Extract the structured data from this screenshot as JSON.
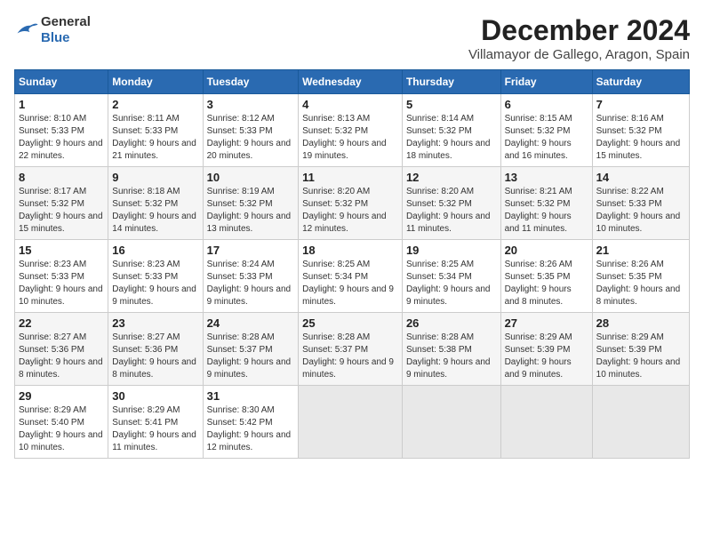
{
  "header": {
    "logo_general": "General",
    "logo_blue": "Blue",
    "title": "December 2024",
    "subtitle": "Villamayor de Gallego, Aragon, Spain"
  },
  "days_of_week": [
    "Sunday",
    "Monday",
    "Tuesday",
    "Wednesday",
    "Thursday",
    "Friday",
    "Saturday"
  ],
  "weeks": [
    [
      {
        "day": "1",
        "sunrise": "8:10 AM",
        "sunset": "5:33 PM",
        "daylight": "9 hours and 22 minutes."
      },
      {
        "day": "2",
        "sunrise": "8:11 AM",
        "sunset": "5:33 PM",
        "daylight": "9 hours and 21 minutes."
      },
      {
        "day": "3",
        "sunrise": "8:12 AM",
        "sunset": "5:33 PM",
        "daylight": "9 hours and 20 minutes."
      },
      {
        "day": "4",
        "sunrise": "8:13 AM",
        "sunset": "5:32 PM",
        "daylight": "9 hours and 19 minutes."
      },
      {
        "day": "5",
        "sunrise": "8:14 AM",
        "sunset": "5:32 PM",
        "daylight": "9 hours and 18 minutes."
      },
      {
        "day": "6",
        "sunrise": "8:15 AM",
        "sunset": "5:32 PM",
        "daylight": "9 hours and 16 minutes."
      },
      {
        "day": "7",
        "sunrise": "8:16 AM",
        "sunset": "5:32 PM",
        "daylight": "9 hours and 15 minutes."
      }
    ],
    [
      {
        "day": "8",
        "sunrise": "8:17 AM",
        "sunset": "5:32 PM",
        "daylight": "9 hours and 15 minutes."
      },
      {
        "day": "9",
        "sunrise": "8:18 AM",
        "sunset": "5:32 PM",
        "daylight": "9 hours and 14 minutes."
      },
      {
        "day": "10",
        "sunrise": "8:19 AM",
        "sunset": "5:32 PM",
        "daylight": "9 hours and 13 minutes."
      },
      {
        "day": "11",
        "sunrise": "8:20 AM",
        "sunset": "5:32 PM",
        "daylight": "9 hours and 12 minutes."
      },
      {
        "day": "12",
        "sunrise": "8:20 AM",
        "sunset": "5:32 PM",
        "daylight": "9 hours and 11 minutes."
      },
      {
        "day": "13",
        "sunrise": "8:21 AM",
        "sunset": "5:32 PM",
        "daylight": "9 hours and 11 minutes."
      },
      {
        "day": "14",
        "sunrise": "8:22 AM",
        "sunset": "5:33 PM",
        "daylight": "9 hours and 10 minutes."
      }
    ],
    [
      {
        "day": "15",
        "sunrise": "8:23 AM",
        "sunset": "5:33 PM",
        "daylight": "9 hours and 10 minutes."
      },
      {
        "day": "16",
        "sunrise": "8:23 AM",
        "sunset": "5:33 PM",
        "daylight": "9 hours and 9 minutes."
      },
      {
        "day": "17",
        "sunrise": "8:24 AM",
        "sunset": "5:33 PM",
        "daylight": "9 hours and 9 minutes."
      },
      {
        "day": "18",
        "sunrise": "8:25 AM",
        "sunset": "5:34 PM",
        "daylight": "9 hours and 9 minutes."
      },
      {
        "day": "19",
        "sunrise": "8:25 AM",
        "sunset": "5:34 PM",
        "daylight": "9 hours and 9 minutes."
      },
      {
        "day": "20",
        "sunrise": "8:26 AM",
        "sunset": "5:35 PM",
        "daylight": "9 hours and 8 minutes."
      },
      {
        "day": "21",
        "sunrise": "8:26 AM",
        "sunset": "5:35 PM",
        "daylight": "9 hours and 8 minutes."
      }
    ],
    [
      {
        "day": "22",
        "sunrise": "8:27 AM",
        "sunset": "5:36 PM",
        "daylight": "9 hours and 8 minutes."
      },
      {
        "day": "23",
        "sunrise": "8:27 AM",
        "sunset": "5:36 PM",
        "daylight": "9 hours and 8 minutes."
      },
      {
        "day": "24",
        "sunrise": "8:28 AM",
        "sunset": "5:37 PM",
        "daylight": "9 hours and 9 minutes."
      },
      {
        "day": "25",
        "sunrise": "8:28 AM",
        "sunset": "5:37 PM",
        "daylight": "9 hours and 9 minutes."
      },
      {
        "day": "26",
        "sunrise": "8:28 AM",
        "sunset": "5:38 PM",
        "daylight": "9 hours and 9 minutes."
      },
      {
        "day": "27",
        "sunrise": "8:29 AM",
        "sunset": "5:39 PM",
        "daylight": "9 hours and 9 minutes."
      },
      {
        "day": "28",
        "sunrise": "8:29 AM",
        "sunset": "5:39 PM",
        "daylight": "9 hours and 10 minutes."
      }
    ],
    [
      {
        "day": "29",
        "sunrise": "8:29 AM",
        "sunset": "5:40 PM",
        "daylight": "9 hours and 10 minutes."
      },
      {
        "day": "30",
        "sunrise": "8:29 AM",
        "sunset": "5:41 PM",
        "daylight": "9 hours and 11 minutes."
      },
      {
        "day": "31",
        "sunrise": "8:30 AM",
        "sunset": "5:42 PM",
        "daylight": "9 hours and 12 minutes."
      },
      null,
      null,
      null,
      null
    ]
  ]
}
